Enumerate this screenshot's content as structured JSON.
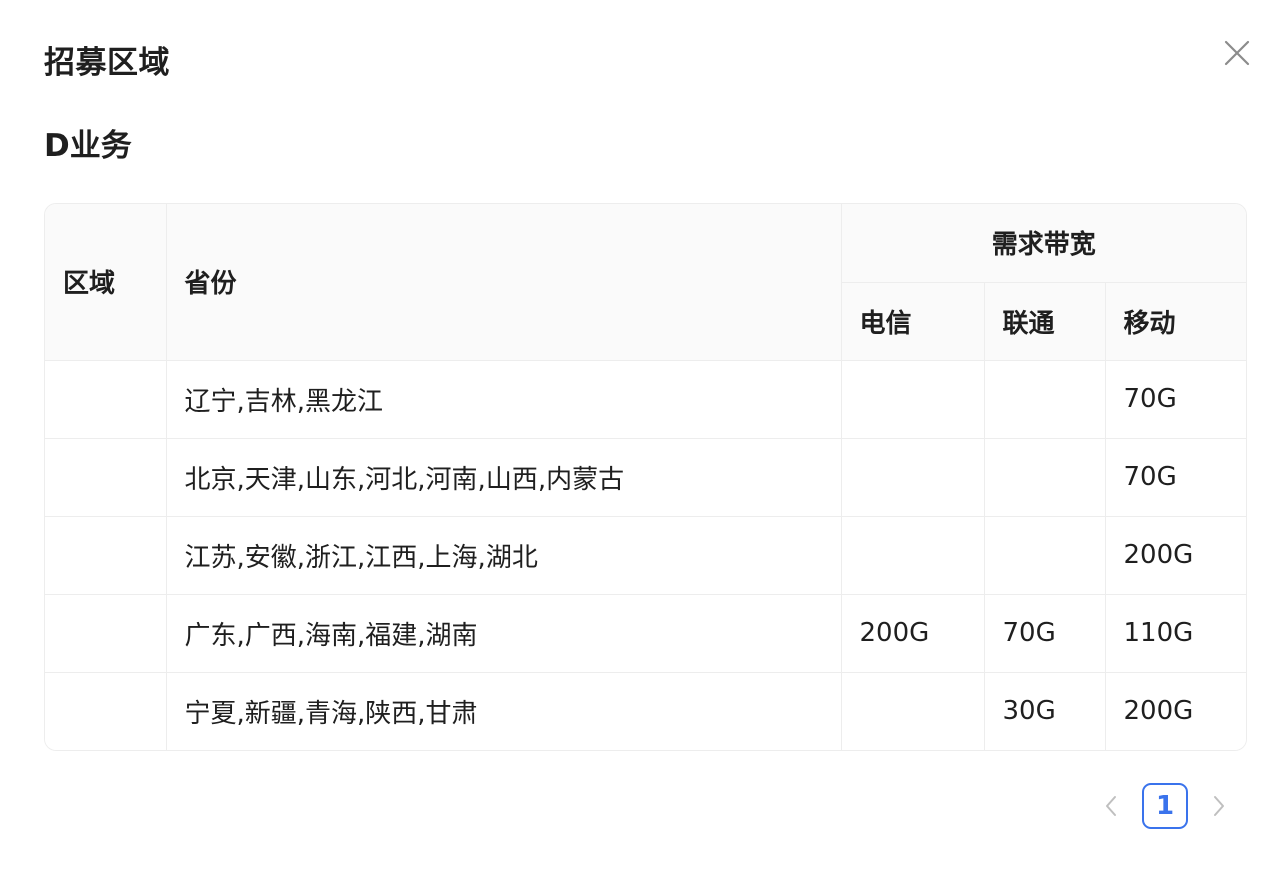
{
  "modal": {
    "title": "招募区域",
    "close_icon": "close-icon"
  },
  "section": {
    "title": "D业务"
  },
  "table": {
    "headers": {
      "region": "区域",
      "province": "省份",
      "bandwidth_group": "需求带宽",
      "telecom": "电信",
      "unicom": "联通",
      "mobile": "移动"
    },
    "rows": [
      {
        "region": "",
        "province": "辽宁,吉林,黑龙江",
        "telecom": "",
        "unicom": "",
        "mobile": "70G"
      },
      {
        "region": "",
        "province": "北京,天津,山东,河北,河南,山西,内蒙古",
        "telecom": "",
        "unicom": "",
        "mobile": "70G"
      },
      {
        "region": "",
        "province": "江苏,安徽,浙江,江西,上海,湖北",
        "telecom": "",
        "unicom": "",
        "mobile": "200G"
      },
      {
        "region": "",
        "province": "广东,广西,海南,福建,湖南",
        "telecom": "200G",
        "unicom": "70G",
        "mobile": "110G"
      },
      {
        "region": "",
        "province": "宁夏,新疆,青海,陕西,甘肃",
        "telecom": "",
        "unicom": "30G",
        "mobile": "200G"
      }
    ]
  },
  "pagination": {
    "current_page": "1",
    "prev_icon": "chevron-left-icon",
    "next_icon": "chevron-right-icon"
  },
  "colors": {
    "accent": "#3a73ec",
    "header_bg": "#fafafa",
    "border": "#ededed"
  }
}
